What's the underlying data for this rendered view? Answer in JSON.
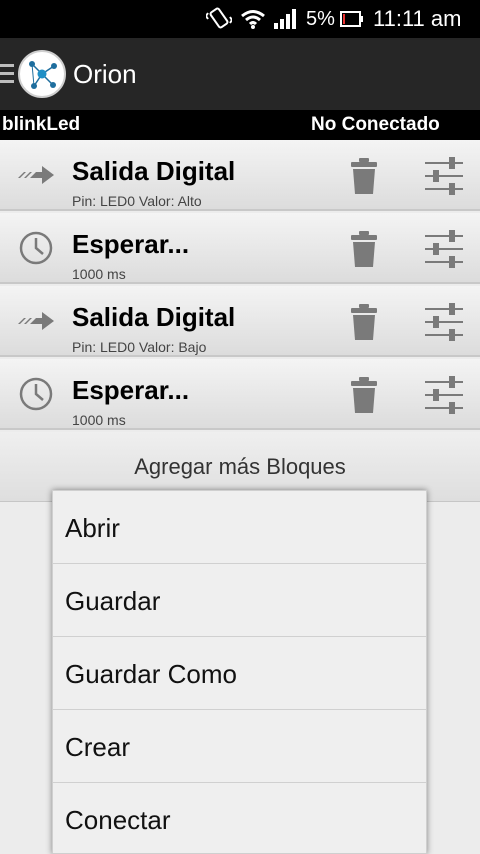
{
  "status_bar": {
    "battery_percent": "5%",
    "time": "11:11 am",
    "icons": [
      "vibrate-icon",
      "wifi-icon",
      "signal-icon",
      "battery-icon"
    ]
  },
  "action_bar": {
    "title": "Orion",
    "icons": [
      "menu-icon",
      "app-logo-icon"
    ]
  },
  "project_bar": {
    "name": "blinkLed",
    "status": "No Conectado"
  },
  "blocks": [
    {
      "title": "Salida Digital",
      "subtitle": "Pin: LED0 Valor: Alto",
      "icon": "arrow-icon"
    },
    {
      "title": "Esperar...",
      "subtitle": "1000 ms",
      "icon": "clock-icon"
    },
    {
      "title": "Salida Digital",
      "subtitle": "Pin: LED0 Valor: Bajo",
      "icon": "arrow-icon"
    },
    {
      "title": "Esperar...",
      "subtitle": "1000 ms",
      "icon": "clock-icon"
    }
  ],
  "add_blocks": {
    "label": "Agregar más Bloques"
  },
  "popup_menu": {
    "items": [
      {
        "label": "Abrir"
      },
      {
        "label": "Guardar"
      },
      {
        "label": "Guardar Como"
      },
      {
        "label": "Crear"
      },
      {
        "label": "Conectar"
      }
    ]
  },
  "colors": {
    "status_bar_bg": "#000000",
    "action_bar_bg": "#262626",
    "logo_accent": "#1e6e9e",
    "block_icon": "#7a7a7a"
  }
}
